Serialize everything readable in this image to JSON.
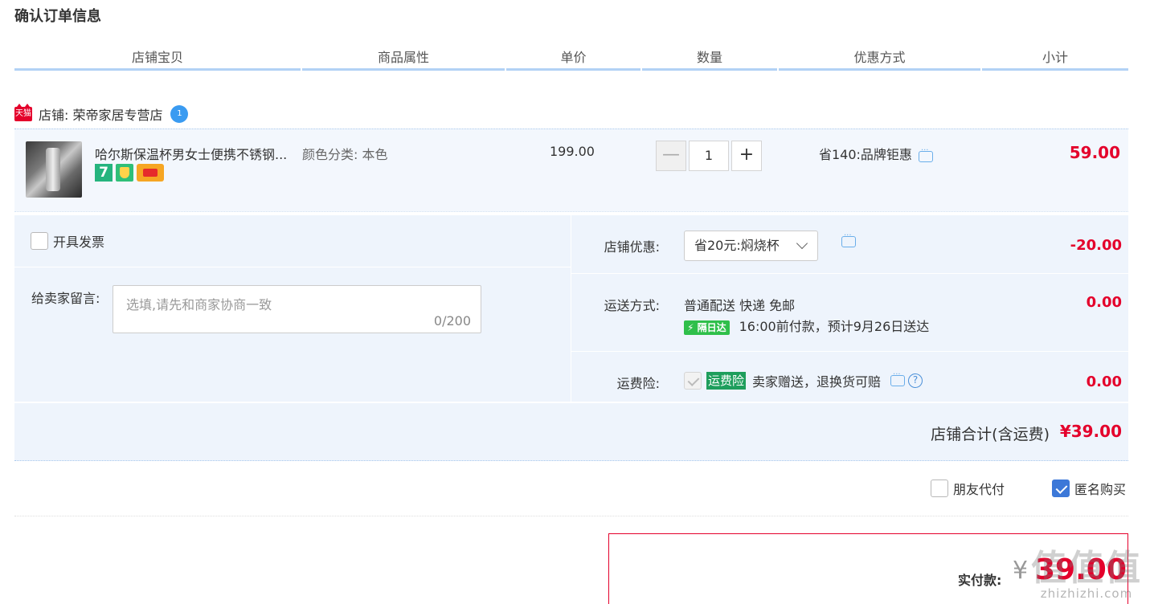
{
  "page_title": "确认订单信息",
  "columns": [
    "店铺宝贝",
    "商品属性",
    "单价",
    "数量",
    "优惠方式",
    "小计"
  ],
  "store": {
    "badge": "天猫",
    "label": "店铺: 荣帝家居专营店"
  },
  "item": {
    "title": "哈尔斯保温杯男女士便携不锈钢...",
    "attribute": "颜色分类: 本色",
    "unit_price": "199.00",
    "quantity": "1",
    "qty_minus": "—",
    "qty_plus": "+",
    "badge_7": "7",
    "promo": "省140:品牌钜惠",
    "subtotal": "59.00"
  },
  "invoice": {
    "label": "开具发票",
    "checked": false
  },
  "message": {
    "label": "给卖家留言:",
    "placeholder": "选填,请先和商家协商一致",
    "count": "0/200"
  },
  "store_discount": {
    "label": "店铺优惠:",
    "selected": "省20元:焖烧杯",
    "amount": "-20.00"
  },
  "shipping": {
    "label": "运送方式:",
    "method": "普通配送 快递 免邮",
    "next_day_tag": "隔日达",
    "eta": "16:00前付款，预计9月26日送达",
    "amount": "0.00"
  },
  "insurance": {
    "label": "运费险:",
    "tag": "运费险",
    "text": "卖家赠送，退换货可赔",
    "help": "?",
    "amount": "0.00"
  },
  "store_total": {
    "label": "店铺合计(含运费)",
    "value": "¥39.00"
  },
  "options": {
    "friend_pay": {
      "label": "朋友代付",
      "checked": false
    },
    "anonymous": {
      "label": "匿名购买",
      "checked": true
    }
  },
  "payment": {
    "label": "实付款:",
    "currency": "¥",
    "value": "39.00"
  },
  "watermark": {
    "big": "值值值",
    "small": "zhizhizhi.com"
  },
  "colors": {
    "accent_red": "#e4002b",
    "header_line": "#b2d1f5",
    "panel_bg": "#eef4fc"
  }
}
